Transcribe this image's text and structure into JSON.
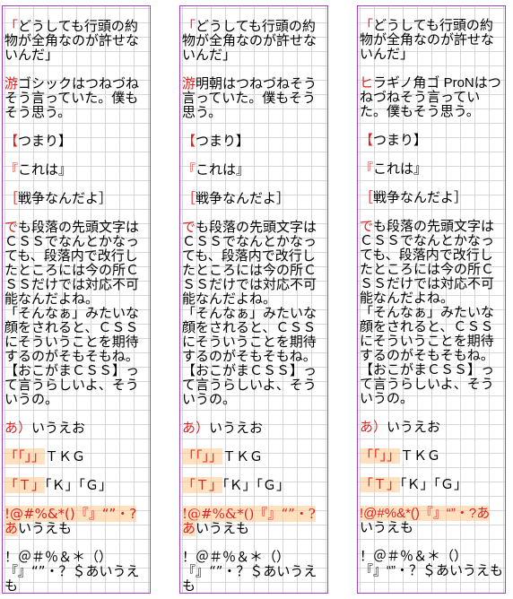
{
  "accent_color": "#e02020",
  "border_color": "#a040c0",
  "grid_color": "#d7d7d7",
  "columns": [
    {
      "paragraphs": [
        {
          "first": "「",
          "rest": "どうしても行頭の約物が全角なのが許せないんだ」"
        },
        {
          "first": "游",
          "rest": "ゴシックはつねづねそう言っていた。僕もそう思う。"
        },
        {
          "first": "【",
          "rest": "つまり】"
        },
        {
          "first": "『",
          "rest": "これは』"
        },
        {
          "first": "［",
          "rest": "戦争なんだよ］"
        },
        {
          "first": "で",
          "rest": "も段落の先頭文字はＣＳＳでなんとかなっても、段落内で改行したところには今の所ＣＳＳだけでは対応不可能なんだよね。\n「そんなぁ」みたいな顔をされると、ＣＳＳにそういうことを期待するのがそもそもね。\n【おこがまＣＳＳ】って言うらしいよ、そういうの。"
        },
        {
          "first": "あ）",
          "rest": "いうえお"
        },
        {
          "first": "「「」」",
          "rest": "ＴＫＧ"
        },
        {
          "first": "「Ｔ」",
          "rest": "「Ｋ」「Ｇ」"
        },
        {
          "first": "!@#%&*()『』“”・?あ",
          "rest": "いうえも"
        },
        {
          "first": "",
          "rest": "！＠＃％＆＊（）『』“”・？＄あいうえも"
        }
      ]
    },
    {
      "paragraphs": [
        {
          "first": "「",
          "rest": "どうしても行頭の約物が全角なのが許せないんだ」"
        },
        {
          "first": "游",
          "rest": "明朝はつねづねそう言っていた。僕もそう思う。"
        },
        {
          "first": "【",
          "rest": "つまり】"
        },
        {
          "first": "『",
          "rest": "これは』"
        },
        {
          "first": "［",
          "rest": "戦争なんだよ］"
        },
        {
          "first": "で",
          "rest": "も段落の先頭文字はＣＳＳでなんとかなっても、段落内で改行したところには今の所ＣＳＳだけでは対応不可能なんだよね。\n「そんなぁ」みたいな顔をされると、ＣＳＳにそういうことを期待するのがそもそもね。\n【おこがまＣＳＳ】って言うらしいよ、そういうの。"
        },
        {
          "first": "あ）",
          "rest": "いうえお"
        },
        {
          "first": "「「」」",
          "rest": "ＴＫＧ"
        },
        {
          "first": "「Ｔ」",
          "rest": "「Ｋ」「Ｇ」"
        },
        {
          "first": "!@#%&*()『』“”・?あ",
          "rest": "いうえも"
        },
        {
          "first": "",
          "rest": "！＠＃％＆＊（）『』“”・？＄あいうえも"
        }
      ]
    },
    {
      "paragraphs": [
        {
          "first": "「",
          "rest": "どうしても行頭の約物が全角なのが許せないんだ」"
        },
        {
          "first": "ヒ",
          "rest": "ラギノ角ゴ ProNはつねづねそう言っていた。僕もそう思う。"
        },
        {
          "first": "【",
          "rest": "つまり】"
        },
        {
          "first": "『",
          "rest": "これは』"
        },
        {
          "first": "［",
          "rest": "戦争なんだよ］"
        },
        {
          "first": "で",
          "rest": "も段落の先頭文字はＣＳＳでなんとかなっても、段落内で改行したところには今の所ＣＳＳだけでは対応不可能なんだよね。\n「そんなぁ」みたいな顔をされると、ＣＳＳにそういうことを期待するのがそもそもね。\n【おこがまＣＳＳ】って言うらしいよ、そういうの。"
        },
        {
          "first": "あ）",
          "rest": "いうえお"
        },
        {
          "first": "「「」」",
          "rest": "ＴＫＧ"
        },
        {
          "first": "「Ｔ」",
          "rest": "「Ｋ」「Ｇ」"
        },
        {
          "first": "!@#%&*()『』“”・?あ",
          "rest": "いうえも"
        },
        {
          "first": "",
          "rest": "！＠＃％＆＊（）『』“”・？＄あいうえも"
        }
      ]
    }
  ]
}
